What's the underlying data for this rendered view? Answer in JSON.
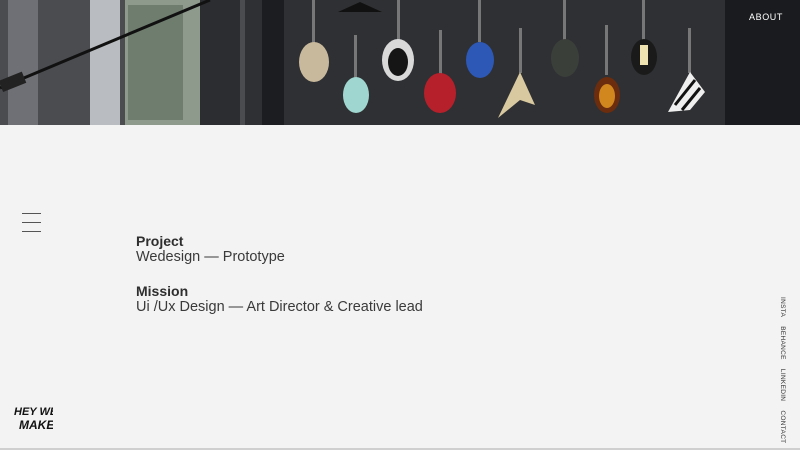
{
  "header": {
    "about_label": "ABOUT"
  },
  "content": {
    "project_label": "Project",
    "project_value": "Wedesign — Prototype",
    "mission_label": "Mission",
    "mission_value": "Ui /Ux Design — Art Director & Creative lead"
  },
  "logo": {
    "text_line1": "HEY WE",
    "text_line2": "MAKE"
  },
  "social": {
    "items": [
      "INSTA",
      "BEHANCE",
      "LINKEDIN",
      "CONTACT"
    ]
  },
  "colors": {
    "background": "#f3f3f3",
    "hero_dark": "#1e1f22",
    "text": "#333333"
  }
}
